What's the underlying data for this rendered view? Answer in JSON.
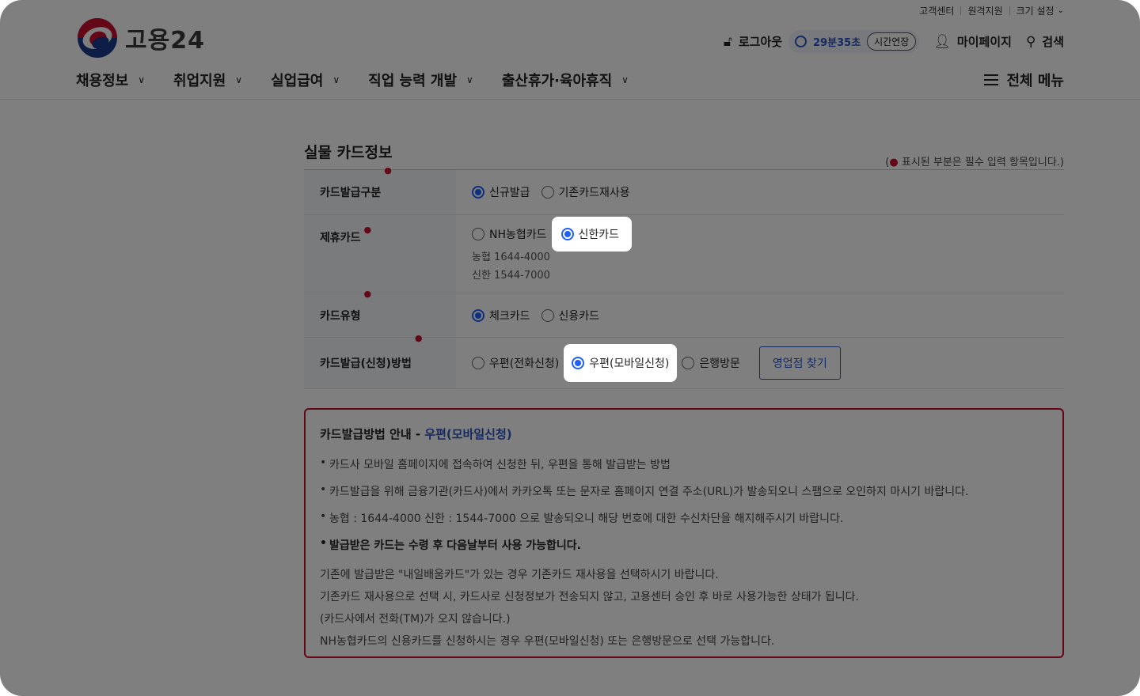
{
  "utility": {
    "customer_center": "고객센터",
    "remote_support": "원격지원",
    "font_size": "크기 설정"
  },
  "logo": {
    "text": "고용24"
  },
  "header": {
    "logout": "로그아웃",
    "timer": "29분35초",
    "extend": "시간연장",
    "mypage": "마이페이지",
    "search": "검색",
    "all_menu": "전체 메뉴"
  },
  "gnb": [
    "채용정보",
    "취업지원",
    "실업급여",
    "직업 능력 개발",
    "출산휴가·육아휴직"
  ],
  "section": {
    "title": "실물 카드정보",
    "required_note": "표시된 부분은 필수 입력 항목입니다.)",
    "required_open": "("
  },
  "form": {
    "issue_type": {
      "label": "카드발급구분",
      "options": [
        "신규발급",
        "기존카드재사용"
      ],
      "selected": "신규발급"
    },
    "partner_card": {
      "label": "제휴카드",
      "options": [
        "NH농협카드",
        "신한카드"
      ],
      "selected": "신한카드",
      "notes": [
        "농협 1644-4000",
        "신한 1544-7000"
      ]
    },
    "card_type": {
      "label": "카드유형",
      "options": [
        "체크카드",
        "신용카드"
      ],
      "selected": "체크카드"
    },
    "issue_method": {
      "label": "카드발급(신청)방법",
      "options": [
        "우편(전화신청)",
        "우편(모바일신청)",
        "은행방문"
      ],
      "selected": "우편(모바일신청)",
      "branch_button": "영업점 찾기"
    }
  },
  "guide": {
    "title": "카드발급방법 안내 - ",
    "title_highlight": "우편(모바일신청)",
    "bullets": [
      "카드사 모바일 홈페이지에 접속하여 신청한 뒤, 우편을 통해 발급받는 방법",
      "카드발급을 위해 금융기관(카드사)에서 카카오톡 또는 문자로 홈페이지 연결 주소(URL)가 발송되오니 스팸으로 오인하지 마시기 바랍니다.",
      "농협 : 1644-4000 신한 : 1544-7000 으로 발송되오니 해당 번호에 대한 수신차단을 해지해주시기 바랍니다.",
      "발급받은 카드는 수령 후 다음날부터 사용 가능합니다."
    ],
    "notes": [
      "기존에 발급받은 \"내일배움카드\"가 있는 경우 기존카드 재사용을 선택하시기 바랍니다.",
      "기존카드 재사용으로 선택 시, 카드사로 신청정보가 전송되지 않고, 고용센터 승인 후 바로 사용가능한 상태가 됩니다.",
      "(카드사에서 전화(TM)가 오지 않습니다.)",
      "NH농협카드의 신용카드를 신청하시는 경우 우편(모바일신청) 또는 은행방문으로 선택 가능합니다."
    ]
  },
  "colors": {
    "accent": "#2b55c7",
    "radio_on": "#1e5eff",
    "required": "#c8102e"
  }
}
